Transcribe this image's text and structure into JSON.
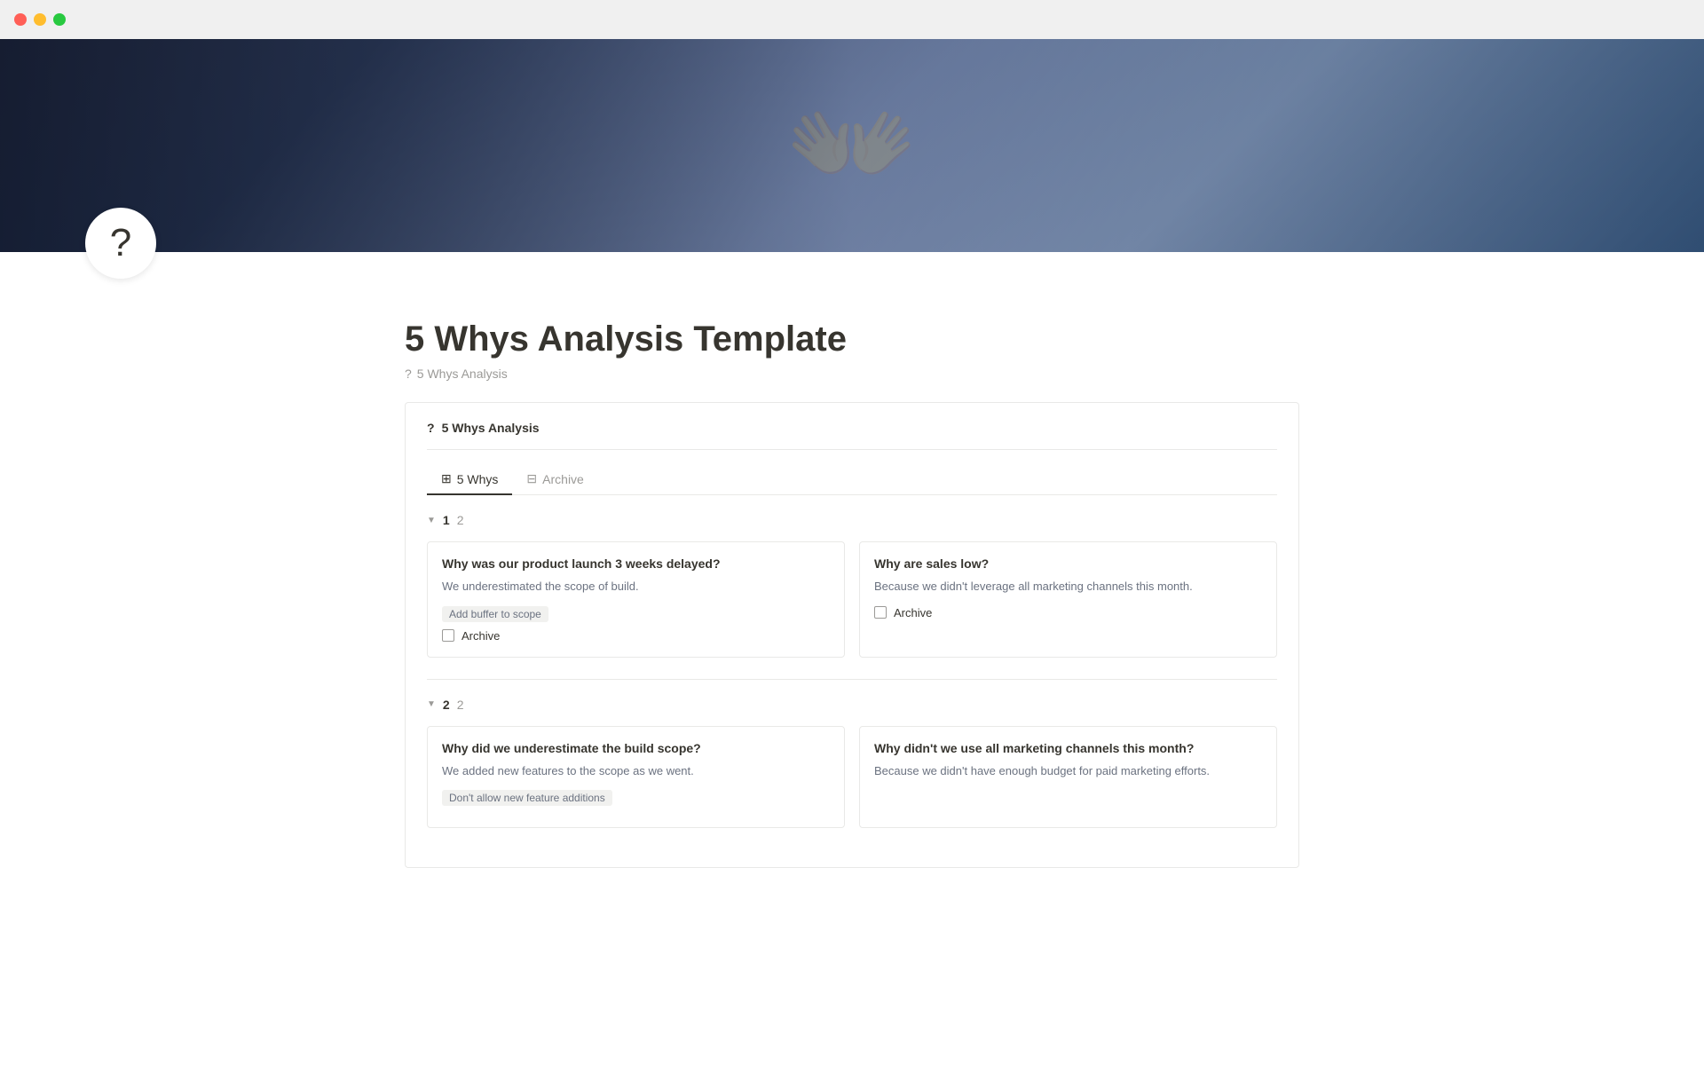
{
  "titlebar": {
    "traffic_lights": [
      "red",
      "yellow",
      "green"
    ]
  },
  "hero": {
    "alt": "Business meeting with tablet"
  },
  "page": {
    "icon": "?",
    "title": "5 Whys Analysis Template",
    "breadcrumb_icon": "?",
    "breadcrumb_text": "5 Whys Analysis"
  },
  "database": {
    "header_icon": "?",
    "header_title": "5 Whys Analysis",
    "tabs": [
      {
        "id": "5whys",
        "label": "5 Whys",
        "active": true,
        "icon": "⊞"
      },
      {
        "id": "archive",
        "label": "Archive",
        "active": false,
        "icon": "⊟"
      }
    ],
    "groups": [
      {
        "arrow": "▼",
        "number": "1",
        "count": "2",
        "cards": [
          {
            "title": "Why was our product launch 3 weeks delayed?",
            "body": "We underestimated the scope of build.",
            "tag": "Add buffer to scope",
            "checkbox_label": "Archive"
          },
          {
            "title": "Why are sales low?",
            "body": "Because we didn't leverage all marketing channels this month.",
            "tag": null,
            "checkbox_label": "Archive"
          }
        ]
      },
      {
        "arrow": "▼",
        "number": "2",
        "count": "2",
        "cards": [
          {
            "title": "Why did we underestimate the build scope?",
            "body": "We added new features to the scope as we went.",
            "tag": "Don't allow new feature additions",
            "checkbox_label": null
          },
          {
            "title": "Why didn't we use all marketing channels this month?",
            "body": "Because we didn't have enough budget for paid marketing efforts.",
            "tag": null,
            "checkbox_label": null
          }
        ]
      }
    ]
  }
}
